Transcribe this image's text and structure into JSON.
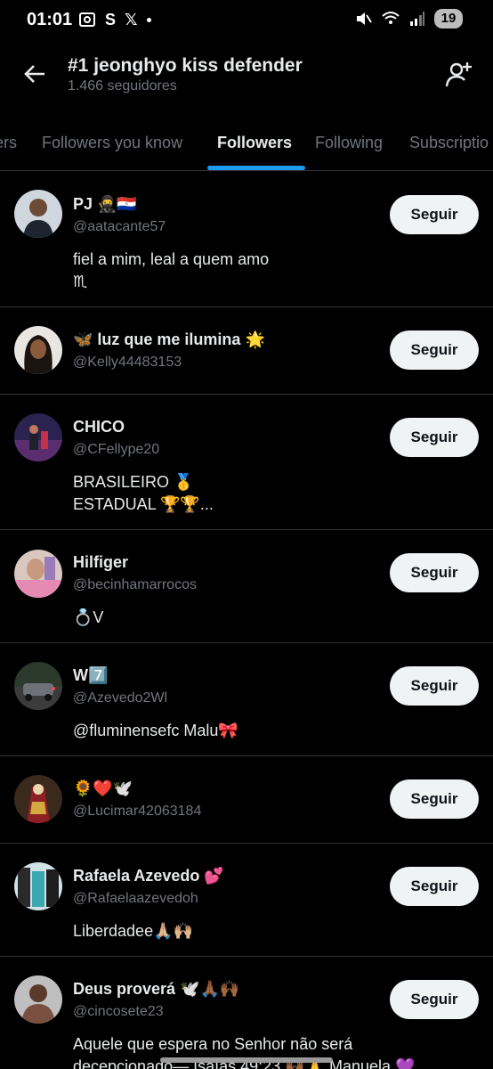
{
  "status_bar": {
    "time": "01:01",
    "battery": "19",
    "s_glyph": "S",
    "x_glyph": "𝕏"
  },
  "header": {
    "title": "#1 jeonghyo kiss defender",
    "subtitle": "1.466 seguidores"
  },
  "tabs": [
    {
      "label": "ers"
    },
    {
      "label": "Followers you know"
    },
    {
      "label": "Followers"
    },
    {
      "label": "Following"
    },
    {
      "label": "Subscriptio"
    }
  ],
  "colors": {
    "accent": "#1d9bf0",
    "background": "#000000",
    "text": "#e7e9ea",
    "muted": "#71767b",
    "button_bg": "#eff3f4"
  },
  "followers": [
    {
      "name": "PJ 🥷🇵🇾",
      "handle": "@aatacante57",
      "bio": "fiel a mim, leal a quem amo\n♏",
      "button": "Seguir"
    },
    {
      "name": "🦋 luz que me ilumina 🌟",
      "handle": "@Kelly44483153",
      "bio": "",
      "button": "Seguir"
    },
    {
      "name": "CHICO",
      "handle": "@CFellype20",
      "bio": "BRASILEIRO 🥇\n ESTADUAL 🏆🏆...",
      "button": "Seguir"
    },
    {
      "name": "Hilfiger",
      "handle": "@becinhamarrocos",
      "bio": "💍V",
      "button": "Seguir"
    },
    {
      "name": "W7️⃣",
      "handle": "@Azevedo2Wl",
      "bio": "@fluminensefc Malu🎀",
      "button": "Seguir"
    },
    {
      "name": "🌻❤️🕊️",
      "handle": "@Lucimar42063184",
      "bio": "",
      "button": "Seguir"
    },
    {
      "name": "Rafaela Azevedo 💕",
      "handle": "@Rafaelaazevedoh",
      "bio": "Liberdadee🙏🏼🙌🏼",
      "button": "Seguir"
    },
    {
      "name": "Deus proverá 🕊️🙏🏾🙌🏾",
      "handle": "@cincosete23",
      "bio": "Aquele que espera no Senhor não será\ndecepcionado— Isaías 49:23 🙌🏾🙏 Manuela 💜",
      "button": "Seguir"
    }
  ]
}
